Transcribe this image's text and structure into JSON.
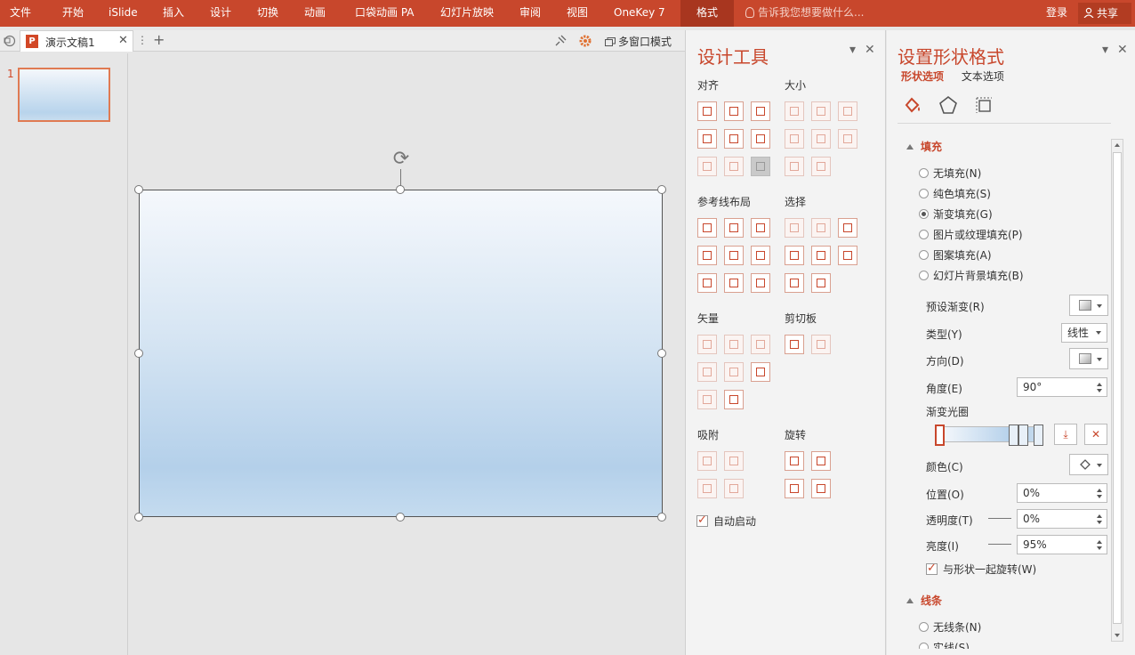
{
  "ribbon": {
    "menus": [
      "文件",
      "开始",
      "iSlide",
      "插入",
      "设计",
      "切换",
      "动画",
      "口袋动画 PA",
      "幻灯片放映",
      "审阅",
      "视图",
      "OneKey 7"
    ],
    "active_tab": "格式",
    "tellme": "告诉我您想要做什么...",
    "login": "登录",
    "share": "共享"
  },
  "tabbar": {
    "doc_title": "演示文稿1",
    "app_badge": "P",
    "multiwindow": "多窗口模式"
  },
  "slides": {
    "thumb_number": "1"
  },
  "design_tools": {
    "title": "设计工具",
    "sections": {
      "align": "对齐",
      "size": "大小",
      "guides": "参考线布局",
      "select": "选择",
      "vector": "矢量",
      "clipboard": "剪切板",
      "snap": "吸附",
      "rotate": "旋转"
    },
    "autostart": "自动启动"
  },
  "format_pane": {
    "title": "设置形状格式",
    "subtabs": [
      "形状选项",
      "文本选项"
    ],
    "fill_header": "填充",
    "fill_options": [
      "无填充(N)",
      "纯色填充(S)",
      "渐变填充(G)",
      "图片或纹理填充(P)",
      "图案填充(A)",
      "幻灯片背景填充(B)"
    ],
    "selected_fill": "渐变填充(G)",
    "labels": {
      "preset": "预设渐变(R)",
      "type": "类型(Y)",
      "direction": "方向(D)",
      "angle": "角度(E)",
      "stops": "渐变光圈",
      "color": "颜色(C)",
      "position": "位置(O)",
      "transparency": "透明度(T)",
      "brightness": "亮度(I)",
      "rotate_with_shape": "与形状一起旋转(W)"
    },
    "values": {
      "type": "线性",
      "angle": "90°",
      "position": "0%",
      "transparency": "0%",
      "brightness": "95%"
    },
    "line_header": "线条",
    "line_options": [
      "无线条(N)",
      "实线(S)"
    ]
  },
  "colors": {
    "accent": "#c8472c",
    "ribbon": "#c8472c"
  }
}
